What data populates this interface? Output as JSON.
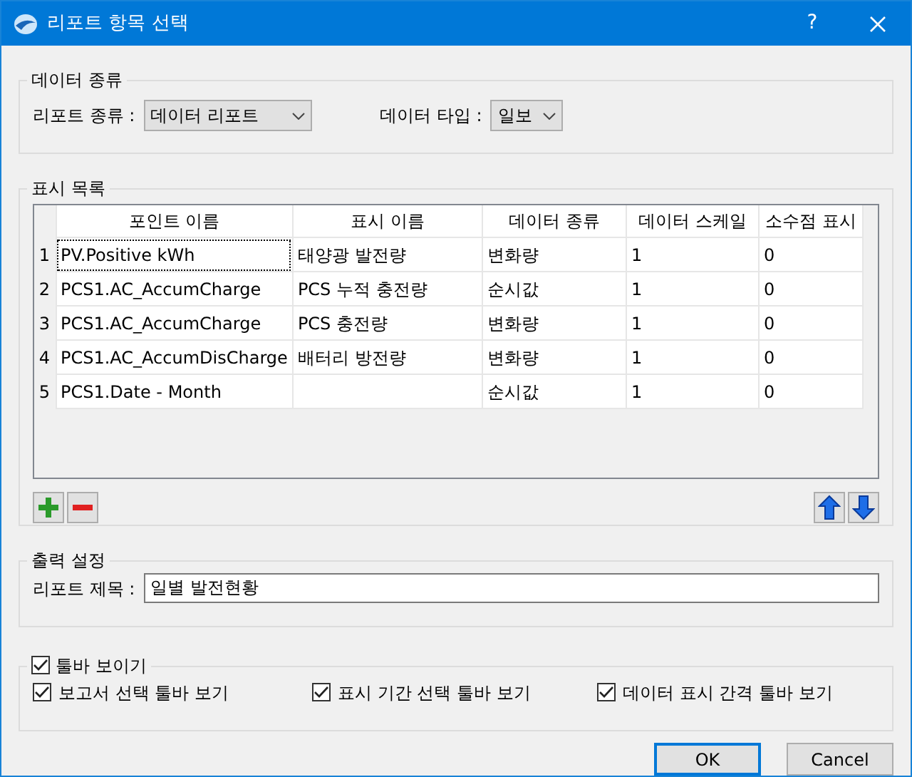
{
  "window": {
    "title": "리포트 항목 선택",
    "help_button": "?"
  },
  "data_kind_group": {
    "title": "데이터 종류",
    "report_type": {
      "label": "리포트 종류 :",
      "value": "데이터 리포트"
    },
    "data_type": {
      "label": "데이터 타입 :",
      "value": "일보"
    }
  },
  "display_list": {
    "title": "표시 목록",
    "columns": [
      "포인트 이름",
      "표시 이름",
      "데이터 종류",
      "데이터 스케일",
      "소수점 표시"
    ],
    "rows": [
      {
        "number": "1",
        "focused": true,
        "cells": [
          "PV.Positive kWh",
          "태양광 발전량",
          "변화량",
          "1",
          "0"
        ]
      },
      {
        "number": "2",
        "focused": false,
        "cells": [
          "PCS1.AC_AccumCharge",
          "PCS 누적 충전량",
          "순시값",
          "1",
          "0"
        ]
      },
      {
        "number": "3",
        "focused": false,
        "cells": [
          "PCS1.AC_AccumCharge",
          "PCS 충전량",
          "변화량",
          "1",
          "0"
        ]
      },
      {
        "number": "4",
        "focused": false,
        "cells": [
          "PCS1.AC_AccumDisCharge",
          "배터리 방전량",
          "변화량",
          "1",
          "0"
        ]
      },
      {
        "number": "5",
        "focused": false,
        "cells": [
          "PCS1.Date - Month",
          "",
          "순시값",
          "1",
          "0"
        ]
      }
    ]
  },
  "output_group": {
    "title": "출력 설정",
    "report_title": {
      "label": "리포트 제목 :",
      "value": "일별 발전현황"
    }
  },
  "toolbar_group": {
    "label": "툴바 보이기",
    "checked": true,
    "options": [
      {
        "label": "보고서 선택 툴바 보기",
        "checked": true
      },
      {
        "label": "표시 기간 선택 툴바 보기",
        "checked": true
      },
      {
        "label": "데이터 표시 간격 툴바 보기",
        "checked": true
      }
    ]
  },
  "buttons": [
    {
      "label": "OK",
      "default": true
    },
    {
      "label": "Cancel",
      "default": false
    }
  ]
}
